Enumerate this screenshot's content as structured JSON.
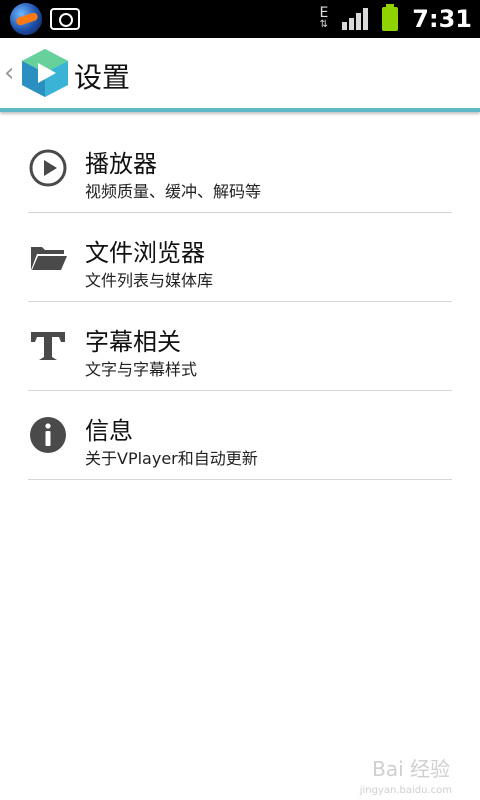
{
  "status_bar": {
    "time": "7:31",
    "network_label": "E",
    "icons": [
      "app-icon",
      "camera-icon",
      "edge-network-icon",
      "signal-icon",
      "battery-icon"
    ],
    "battery_color": "#8fd400"
  },
  "action_bar": {
    "title": "设置",
    "accent_color": "#5fb9c9"
  },
  "settings": [
    {
      "title": "播放器",
      "subtitle": "视频质量、缓冲、解码等",
      "icon": "play-icon"
    },
    {
      "title": "文件浏览器",
      "subtitle": "文件列表与媒体库",
      "icon": "folder-icon"
    },
    {
      "title": "字幕相关",
      "subtitle": "文字与字幕样式",
      "icon": "text-icon"
    },
    {
      "title": "信息",
      "subtitle": "关于VPlayer和自动更新",
      "icon": "info-icon"
    }
  ],
  "watermark": {
    "text": "Bai 经验",
    "url": "jingyan.baidu.com"
  }
}
